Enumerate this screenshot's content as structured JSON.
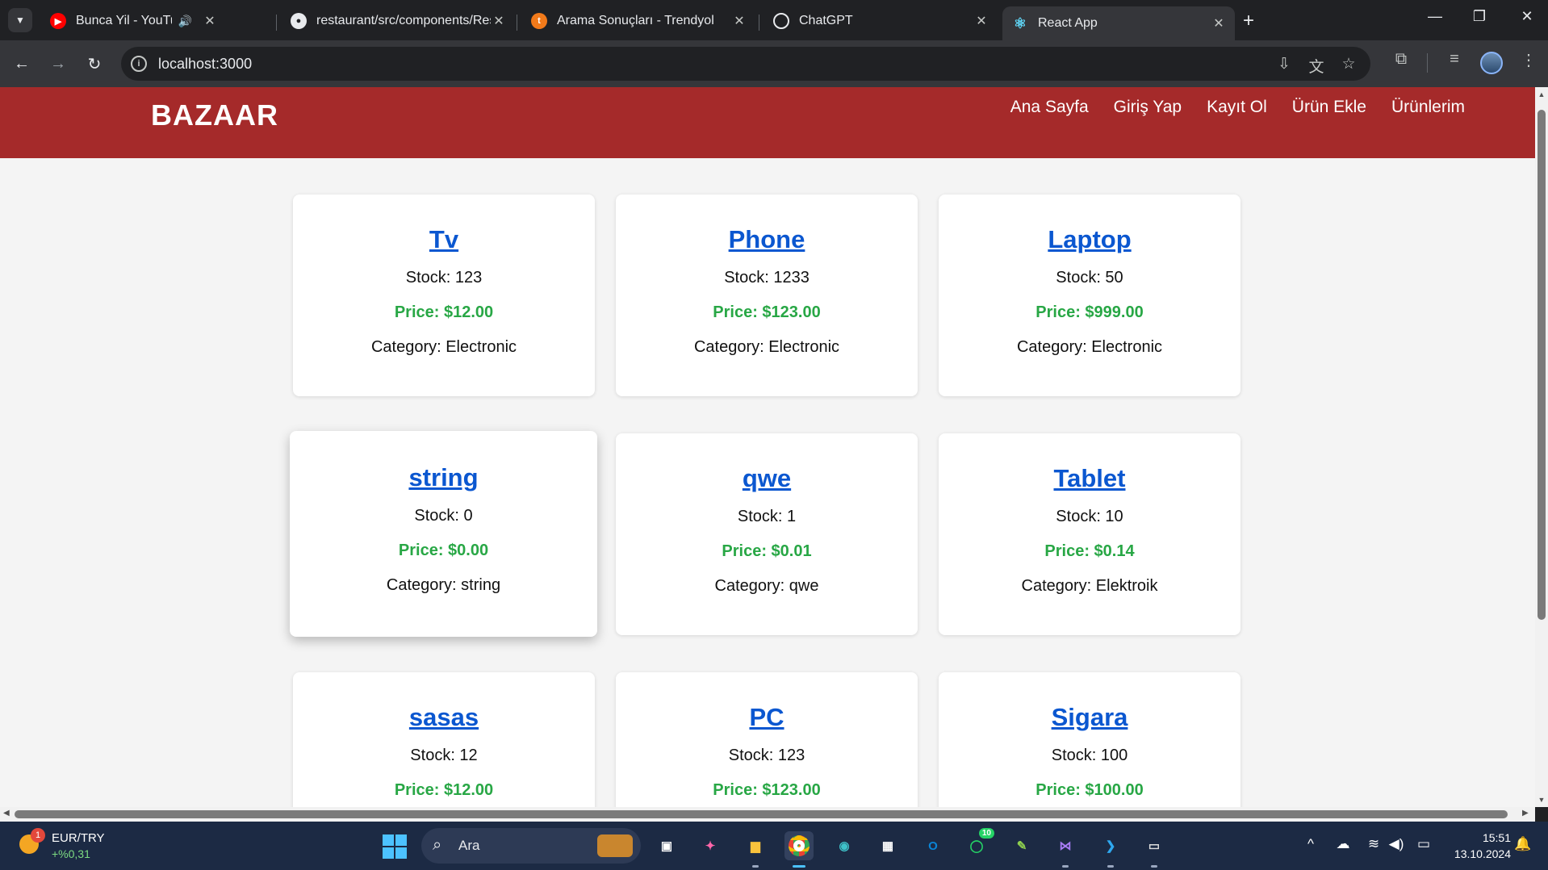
{
  "browser": {
    "tabs": [
      {
        "title": "Bunca Yil - YouTube Music",
        "icon": "youtube-music-icon",
        "audio": true,
        "active": false
      },
      {
        "title": "restaurant/src/components/Res",
        "icon": "github-icon",
        "audio": false,
        "active": false
      },
      {
        "title": "Arama Sonuçları - Trendyol",
        "icon": "trendyol-icon",
        "audio": false,
        "active": false
      },
      {
        "title": "ChatGPT",
        "icon": "chatgpt-icon",
        "audio": false,
        "active": false
      },
      {
        "title": "React App",
        "icon": "react-icon",
        "audio": false,
        "active": true
      }
    ],
    "address": "localhost:3000"
  },
  "site": {
    "brand": "BAZAAR",
    "nav": [
      "Ana Sayfa",
      "Giriş Yap",
      "Kayıt Ol",
      "Ürün Ekle",
      "Ürünlerim"
    ],
    "price_color": "#28a745",
    "link_color": "#0b57d0",
    "header_color": "#a52a2a"
  },
  "products": [
    {
      "name": "Tv",
      "stock": "Stock: 123",
      "price": "Price: $12.00",
      "category": "Category: Electronic"
    },
    {
      "name": "Phone",
      "stock": "Stock: 1233",
      "price": "Price: $123.00",
      "category": "Category: Electronic"
    },
    {
      "name": "Laptop",
      "stock": "Stock: 50",
      "price": "Price: $999.00",
      "category": "Category: Electronic"
    },
    {
      "name": "string",
      "stock": "Stock: 0",
      "price": "Price: $0.00",
      "category": "Category: string"
    },
    {
      "name": "qwe",
      "stock": "Stock: 1",
      "price": "Price: $0.01",
      "category": "Category: qwe"
    },
    {
      "name": "Tablet",
      "stock": "Stock: 10",
      "price": "Price: $0.14",
      "category": "Category: Elektroik"
    },
    {
      "name": "sasas",
      "stock": "Stock: 12",
      "price": "Price: $12.00",
      "category": ""
    },
    {
      "name": "PC",
      "stock": "Stock: 123",
      "price": "Price: $123.00",
      "category": ""
    },
    {
      "name": "Sigara",
      "stock": "Stock: 100",
      "price": "Price: $100.00",
      "category": ""
    }
  ],
  "taskbar": {
    "ticker_name": "EUR/TRY",
    "ticker_change": "+%0,31",
    "weather_badge": "1",
    "search_placeholder": "Ara",
    "whatsapp_badge": "10",
    "time": "15:51",
    "date": "13.10.2024"
  }
}
